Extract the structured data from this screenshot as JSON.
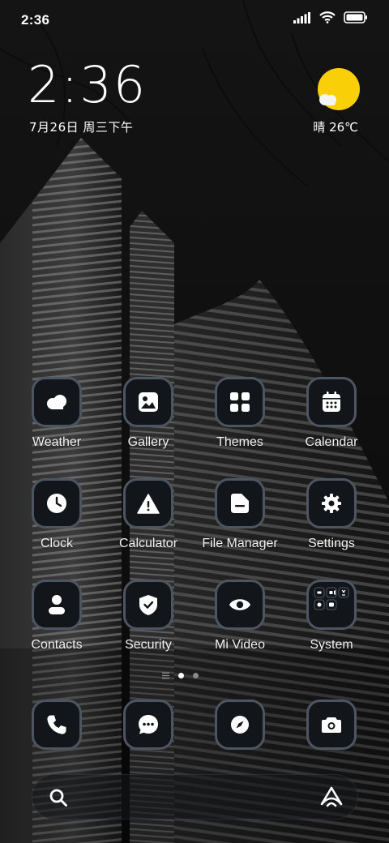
{
  "status_bar": {
    "time": "2:36",
    "icons": [
      "signal-icon",
      "wifi-icon",
      "battery-icon"
    ]
  },
  "clock_widget": {
    "time": "2:36",
    "date": "7月26日 周三下午"
  },
  "weather_widget": {
    "condition_icon": "sun-cloud-icon",
    "text": "晴 26℃",
    "sun_color": "#f9cf07"
  },
  "apps": [
    {
      "label": "Weather",
      "icon": "weather-icon"
    },
    {
      "label": "Gallery",
      "icon": "gallery-icon"
    },
    {
      "label": "Themes",
      "icon": "themes-icon"
    },
    {
      "label": "Calendar",
      "icon": "calendar-icon"
    },
    {
      "label": "Clock",
      "icon": "clock-icon"
    },
    {
      "label": "Calculator",
      "icon": "calculator-icon"
    },
    {
      "label": "File Manager",
      "icon": "file-manager-icon"
    },
    {
      "label": "Settings",
      "icon": "settings-icon"
    },
    {
      "label": "Contacts",
      "icon": "contacts-icon"
    },
    {
      "label": "Security",
      "icon": "security-icon"
    },
    {
      "label": "Mi Video",
      "icon": "video-icon"
    },
    {
      "label": "System",
      "icon": "folder-icon"
    }
  ],
  "page_indicator": {
    "pages": 3,
    "current_page": 2
  },
  "dock": [
    {
      "icon": "phone-icon"
    },
    {
      "icon": "messages-icon"
    },
    {
      "icon": "browser-icon"
    },
    {
      "icon": "camera-icon"
    }
  ],
  "search_bar": {
    "left_icon": "search-icon",
    "right_icon": "assistant-icon"
  },
  "colors": {
    "tile_bg": "#12161b",
    "tile_border": "#4d5560",
    "accent_sun": "#f9cf07"
  }
}
